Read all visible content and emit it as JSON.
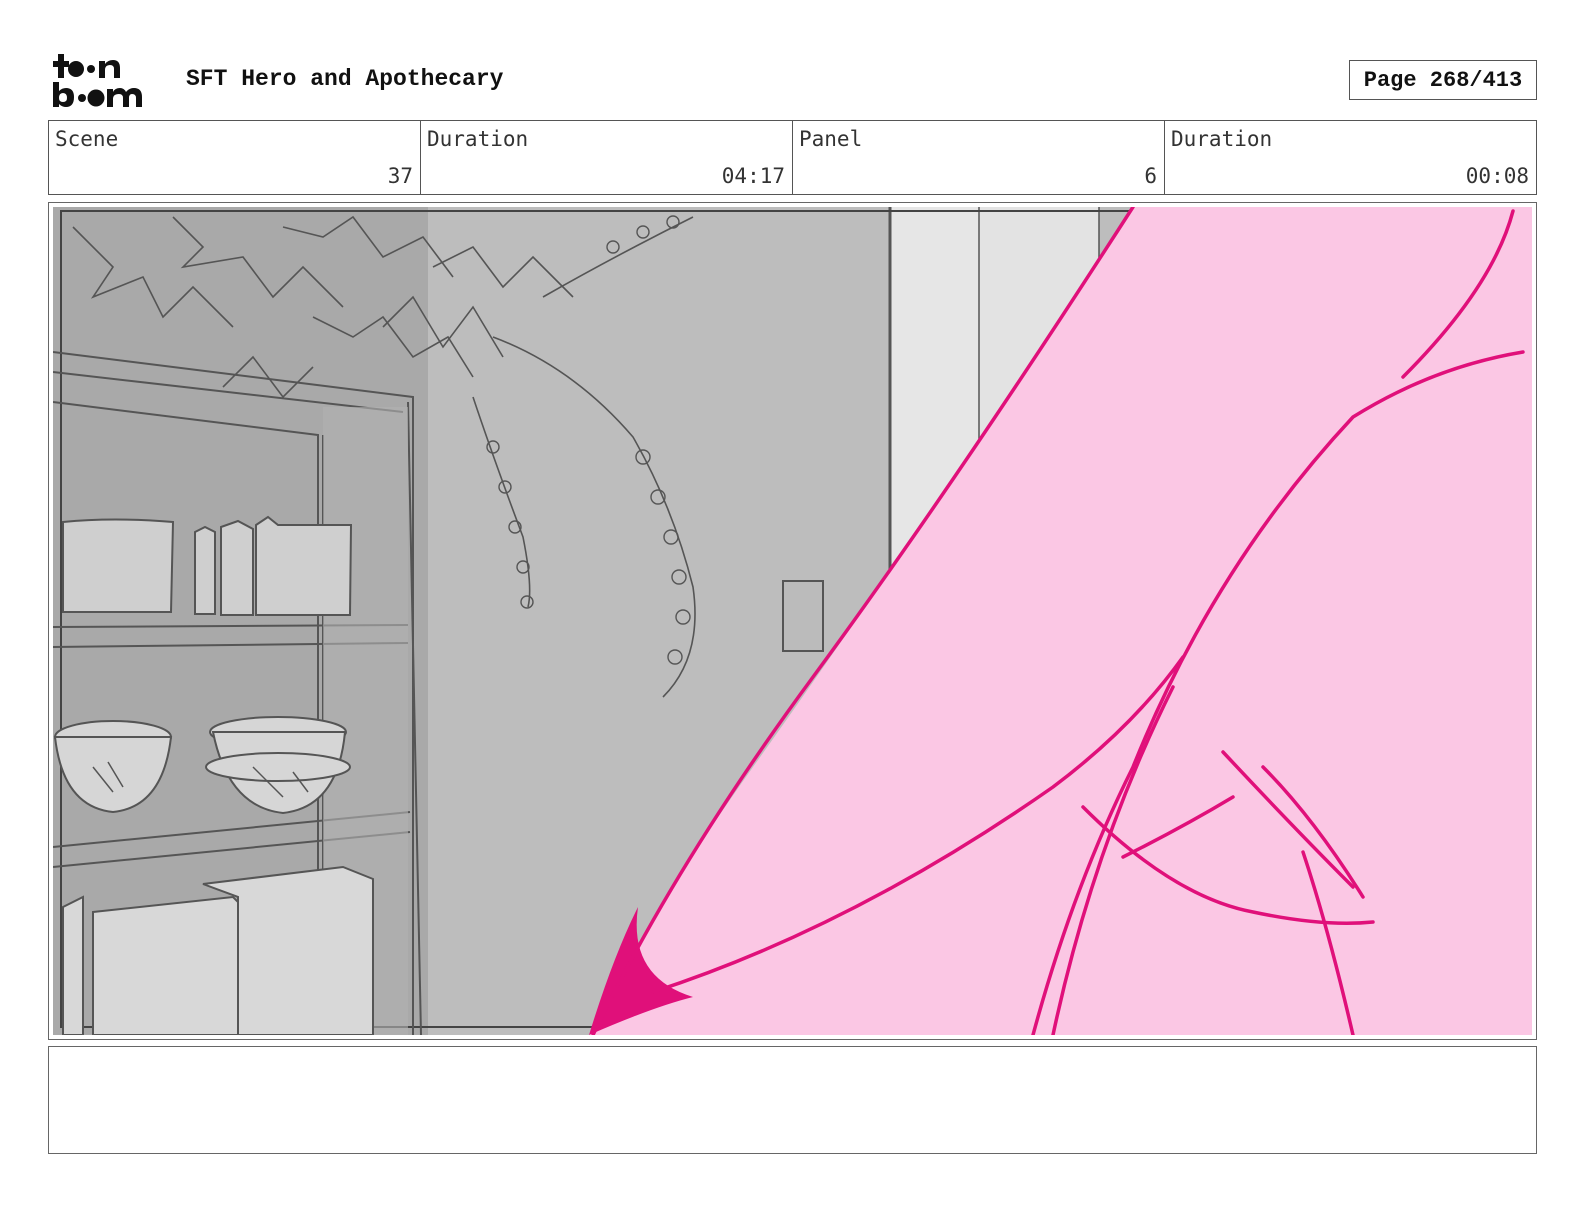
{
  "header": {
    "logo_text": "toon boom",
    "title": "SFT Hero and Apothecary",
    "page_label": "Page 268/413"
  },
  "info": {
    "scene_label": "Scene",
    "scene_value": "37",
    "scene_duration_label": "Duration",
    "scene_duration_value": "04:17",
    "panel_label": "Panel",
    "panel_value": "6",
    "panel_duration_label": "Duration",
    "panel_duration_value": "00:08"
  },
  "colors": {
    "accent_magenta": "#e0107a",
    "fill_pink": "#fbc7e4",
    "wall_gray": "#bdbdbd",
    "shelf_gray": "#a8a8a8"
  },
  "notes": {
    "text": ""
  }
}
